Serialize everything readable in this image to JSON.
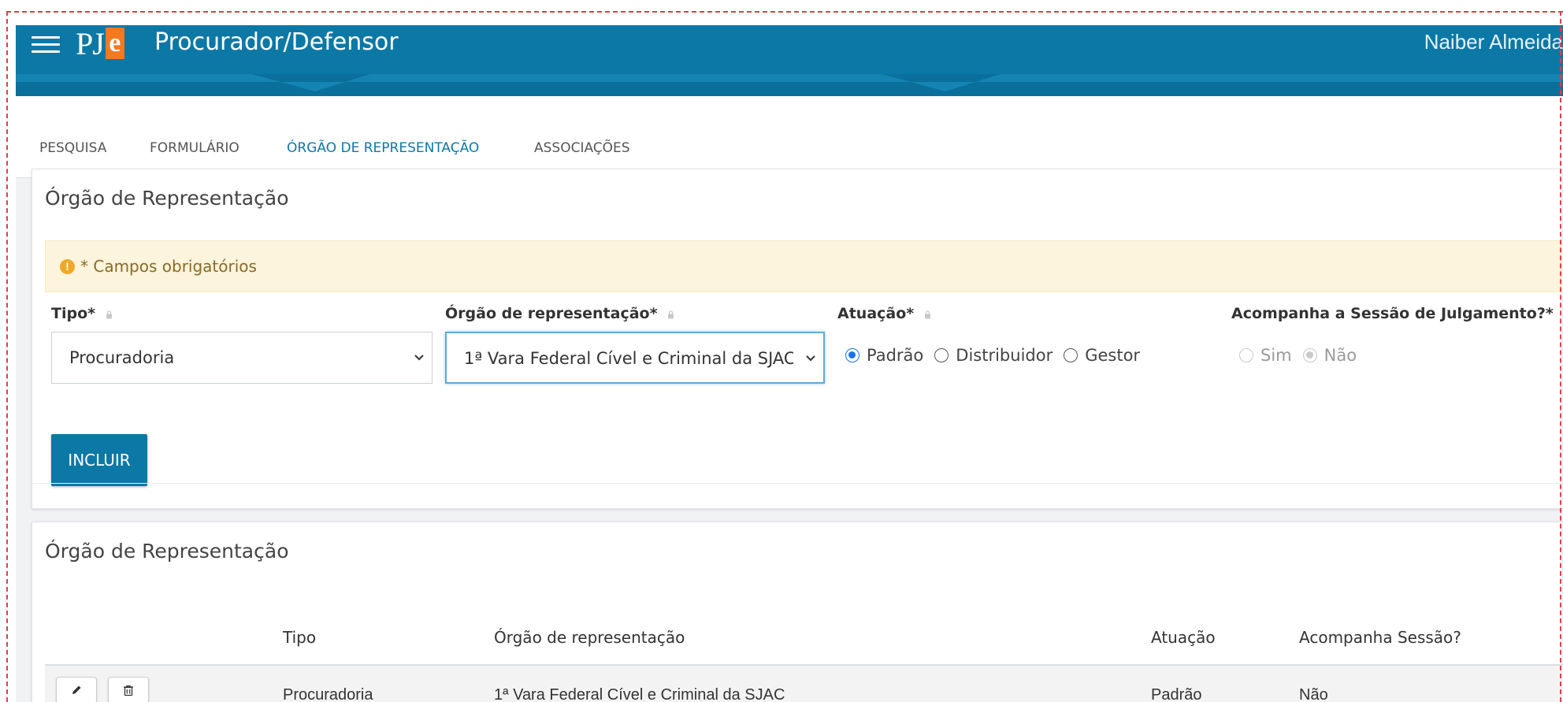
{
  "header": {
    "logo_text": "PJe",
    "title": "Procurador/Defensor",
    "user_name": "Naiber Almeida"
  },
  "tabs": [
    {
      "label": "PESQUISA",
      "active": false
    },
    {
      "label": "FORMULÁRIO",
      "active": false
    },
    {
      "label": "ÓRGÃO DE REPRESENTAÇÃO",
      "active": true
    },
    {
      "label": "ASSOCIAÇÕES",
      "active": false
    }
  ],
  "form_panel": {
    "title": "Órgão de Representação",
    "alert_text": "* Campos obrigatórios",
    "tipo": {
      "label": "Tipo*",
      "value": "Procuradoria"
    },
    "orgao": {
      "label": "Órgão de representação*",
      "value": "1ª Vara Federal Cível e Criminal da SJAC"
    },
    "atuacao": {
      "label": "Atuação*",
      "options": [
        "Padrão",
        "Distribuidor",
        "Gestor"
      ],
      "selected": "Padrão"
    },
    "acompanha": {
      "label": "Acompanha a Sessão de Julgamento?*",
      "options": [
        "Sim",
        "Não"
      ],
      "selected": "Não",
      "disabled": true
    },
    "incluir_label": "INCLUIR"
  },
  "table_panel": {
    "title": "Órgão de Representação",
    "columns": [
      "Tipo",
      "Órgão de representação",
      "Atuação",
      "Acompanha Sessão?"
    ],
    "rows": [
      {
        "tipo": "Procuradoria",
        "orgao": "1ª Vara Federal Cível e Criminal da SJAC",
        "atuacao": "Padrão",
        "acompanha": "Não"
      }
    ]
  },
  "colors": {
    "primary": "#0c78a6",
    "alert_bg": "#fcf4dc",
    "alert_icon": "#f0a72a",
    "logo_accent": "#f47920",
    "frame_dash": "#d9434b"
  },
  "icons": [
    "hamburger-menu-icon",
    "warning-icon",
    "lock-icon",
    "chevron-down-icon",
    "pencil-icon",
    "trash-icon"
  ]
}
